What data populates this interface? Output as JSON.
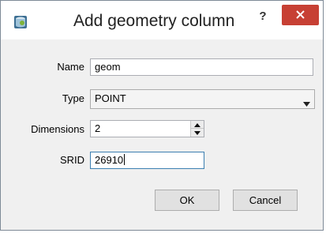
{
  "window": {
    "title": "Add geometry column",
    "help_label": "?",
    "app_icon": "database-icon",
    "close_icon": "close-icon",
    "close_color": "#c74034"
  },
  "form": {
    "name": {
      "label": "Name",
      "value": "geom"
    },
    "type": {
      "label": "Type",
      "value": "POINT"
    },
    "dimensions": {
      "label": "Dimensions",
      "value": "2"
    },
    "srid": {
      "label": "SRID",
      "value": "26910"
    }
  },
  "buttons": {
    "ok": "OK",
    "cancel": "Cancel"
  }
}
